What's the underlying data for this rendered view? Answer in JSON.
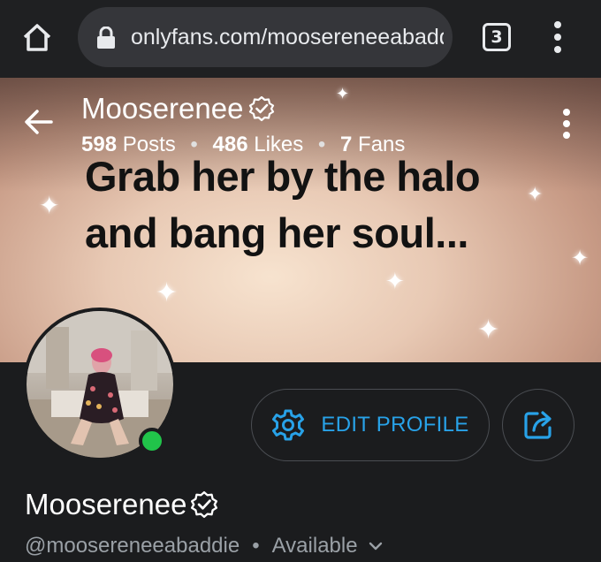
{
  "browser": {
    "url": "onlyfans.com/moosereneeabaddie",
    "tab_count": "3",
    "icons": [
      "home-icon",
      "lock-icon",
      "tabs-icon",
      "more-vert-icon"
    ]
  },
  "banner": {
    "caption_line1": "Grab her by the halo",
    "caption_line2": "and bang her soul...",
    "display_name": "Mooserenee",
    "stats": {
      "posts_count": "598",
      "posts_label": "Posts",
      "likes_count": "486",
      "likes_label": "Likes",
      "fans_count": "7",
      "fans_label": "Fans",
      "separator": "•"
    }
  },
  "actions": {
    "edit_profile_label": "EDIT PROFILE",
    "accent_color": "#28a2e8"
  },
  "profile": {
    "display_name": "Mooserenee",
    "handle": "@moosereneeabaddie",
    "separator": "•",
    "status": "Available",
    "online": true,
    "online_color": "#21c44a"
  }
}
